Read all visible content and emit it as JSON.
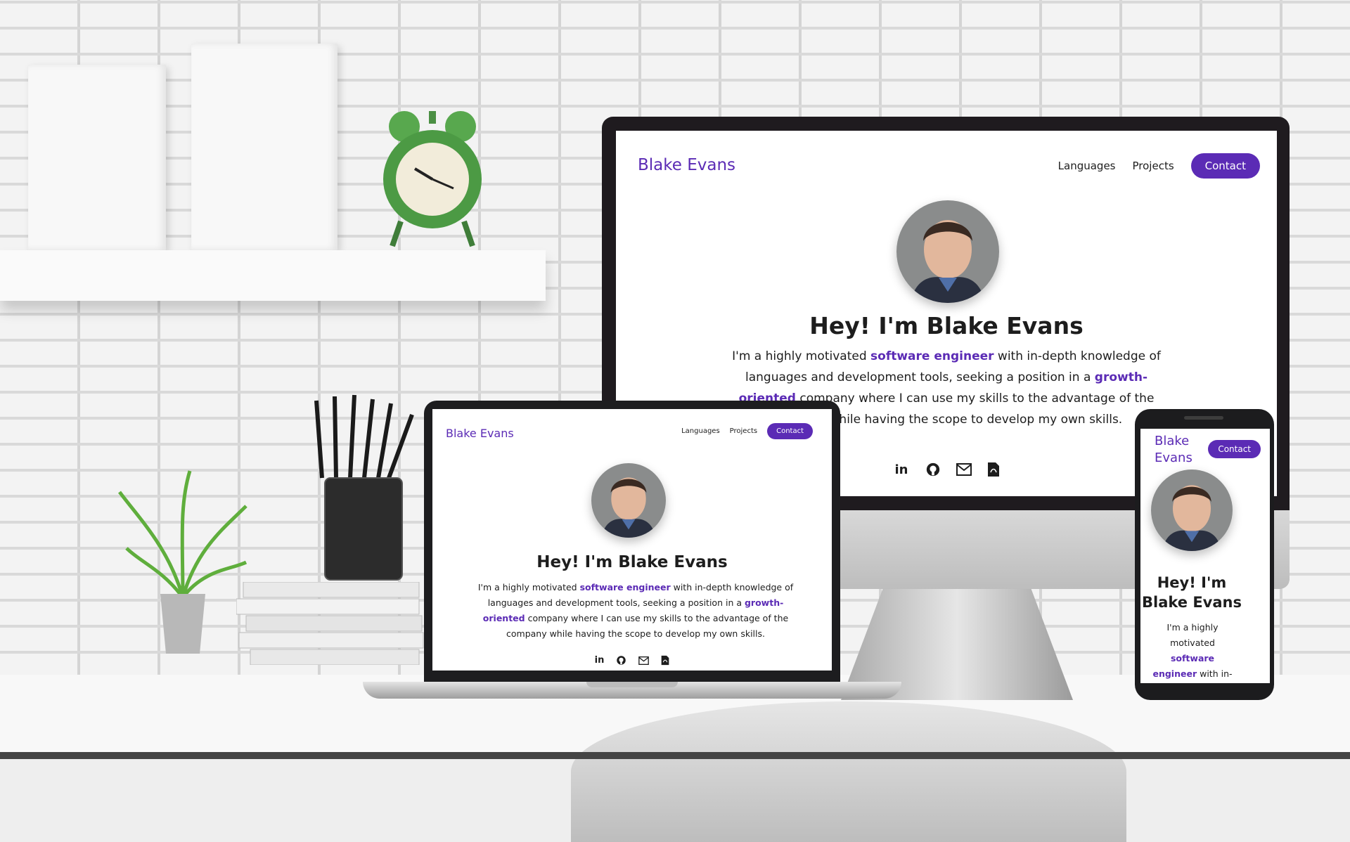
{
  "profile": {
    "name": "Blake Evans",
    "nav": [
      "Languages",
      "Projects"
    ],
    "contact_label": "Contact",
    "headline": "Hey! I'm Blake Evans",
    "intro": {
      "pre1": "I'm a highly motivated ",
      "highlight1": "software engineer",
      "mid": " with in-depth knowledge of languages and development tools, seeking a position in a ",
      "highlight2": "growth-oriented",
      "post": " company where I can use my skills to the advantage of the company while having the scope to develop my own skills."
    },
    "socials": [
      {
        "icon": "linkedin-icon",
        "glyph": "in"
      },
      {
        "icon": "github-icon",
        "glyph": "github"
      },
      {
        "icon": "email-icon",
        "glyph": "mail"
      },
      {
        "icon": "pdf-resume-icon",
        "glyph": "pdf"
      }
    ]
  },
  "phone": {
    "name_line1": "Blake",
    "name_line2": "Evans",
    "headline_line1": "Hey! I'm",
    "headline_line2": "Blake Evans",
    "intro_pre": "I'm a highly motivated ",
    "intro_hl": "software engineer",
    "intro_post": " with in-depth knowledge of"
  },
  "colors": {
    "accent": "#5b2bb5",
    "text": "#1d1d1d",
    "background": "#ffffff"
  }
}
